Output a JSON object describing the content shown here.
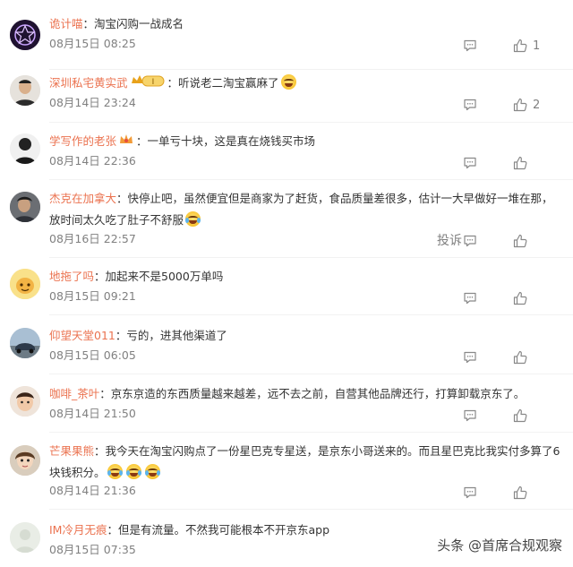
{
  "comments": [
    {
      "user": "诡计喵",
      "text": "淘宝闪购一战成名",
      "time": "08月15日 08:25",
      "likes": "1",
      "avatar": "purple-star-avatar"
    },
    {
      "user": "深圳私宅黄实武",
      "text": "听说老二淘宝赢麻了",
      "time": "08月14日 23:24",
      "likes": "2",
      "avatar": "man-portrait-avatar",
      "badge": "I"
    },
    {
      "user": "学写作的老张",
      "text": "一单亏十块，这是真在烧钱买市场",
      "time": "08月14日 22:36",
      "likes": "",
      "avatar": "dark-figure-avatar"
    },
    {
      "user": "杰克在加拿大",
      "text": "快停止吧，虽然便宜但是商家为了赶货，食品质量差很多，估计一大早做好一堆在那，放时间太久吃了肚子不舒服",
      "time": "08月16日 22:57",
      "likes": "",
      "avatar": "boy-portrait-avatar",
      "report": "投诉"
    },
    {
      "user": "地拖了吗",
      "text": "加起来不是5000万单吗",
      "time": "08月15日 09:21",
      "likes": "",
      "avatar": "yellow-cartoon-avatar"
    },
    {
      "user": "仰望天堂011",
      "text": "亏的，进其他渠道了",
      "time": "08月15日 06:05",
      "likes": "",
      "avatar": "car-landscape-avatar"
    },
    {
      "user": "咖啡_茶叶",
      "text": "京东京造的东西质量越来越差，远不去之前，自营其他品牌还行，打算卸载京东了。",
      "time": "08月14日 21:50",
      "likes": "",
      "avatar": "child-portrait-avatar"
    },
    {
      "user": "芒果果熊",
      "text": "我今天在淘宝闪购点了一份星巴克专星送，是京东小哥送来的。而且星巴克比我实付多算了6块钱积分。",
      "time": "08月14日 21:36",
      "likes": "",
      "avatar": "doll-portrait-avatar"
    },
    {
      "user": "IM冷月无痕",
      "text": "但是有流量。不然我可能根本不开京东app",
      "time": "08月15日 07:35",
      "likes": "",
      "avatar": "blank-avatar"
    }
  ],
  "watermark": "头条 @首席合规观察",
  "colors": {
    "username": "#eb7350",
    "meta": "#808080",
    "text": "#333333"
  }
}
